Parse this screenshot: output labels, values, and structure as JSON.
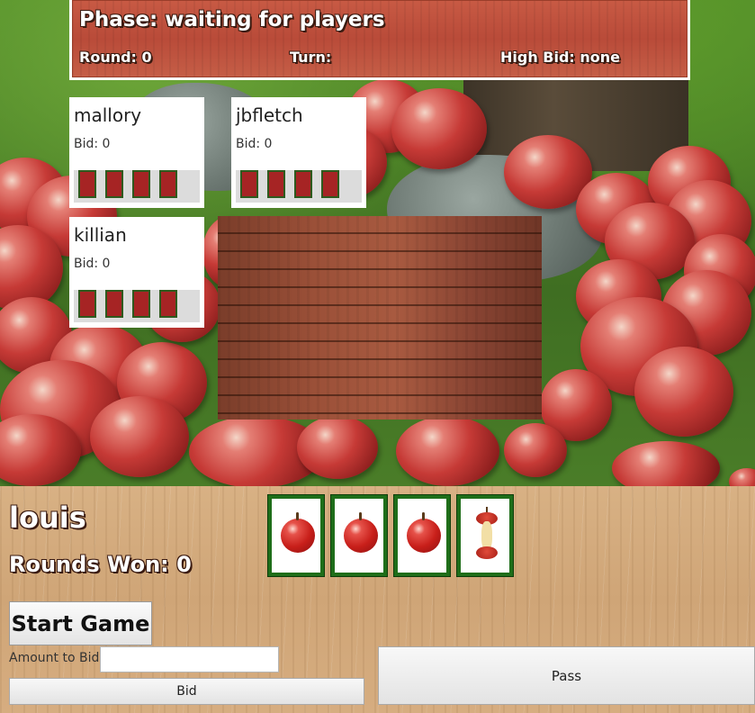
{
  "status": {
    "phase": "Phase: waiting for players",
    "round": "Round: 0",
    "turn": "Turn:",
    "high_bid": "High Bid: none"
  },
  "players": [
    {
      "name": "mallory",
      "bid": "Bid: 0",
      "cards": 4
    },
    {
      "name": "jbfletch",
      "bid": "Bid: 0",
      "cards": 4
    },
    {
      "name": "killian",
      "bid": "Bid: 0",
      "cards": 4
    }
  ],
  "me": {
    "name": "louis",
    "rounds_won": "Rounds Won: 0",
    "hand": [
      "apple-icon",
      "apple-icon",
      "apple-icon",
      "apple-core-icon"
    ]
  },
  "controls": {
    "start_label": "Start Game",
    "bid_amount_label": "Amount to Bid",
    "bid_input_value": "",
    "bid_label": "Bid",
    "pass_label": "Pass"
  },
  "colors": {
    "card_back": "#a62424",
    "card_border": "#1f6e1a",
    "status_bar": "#b94b39"
  }
}
